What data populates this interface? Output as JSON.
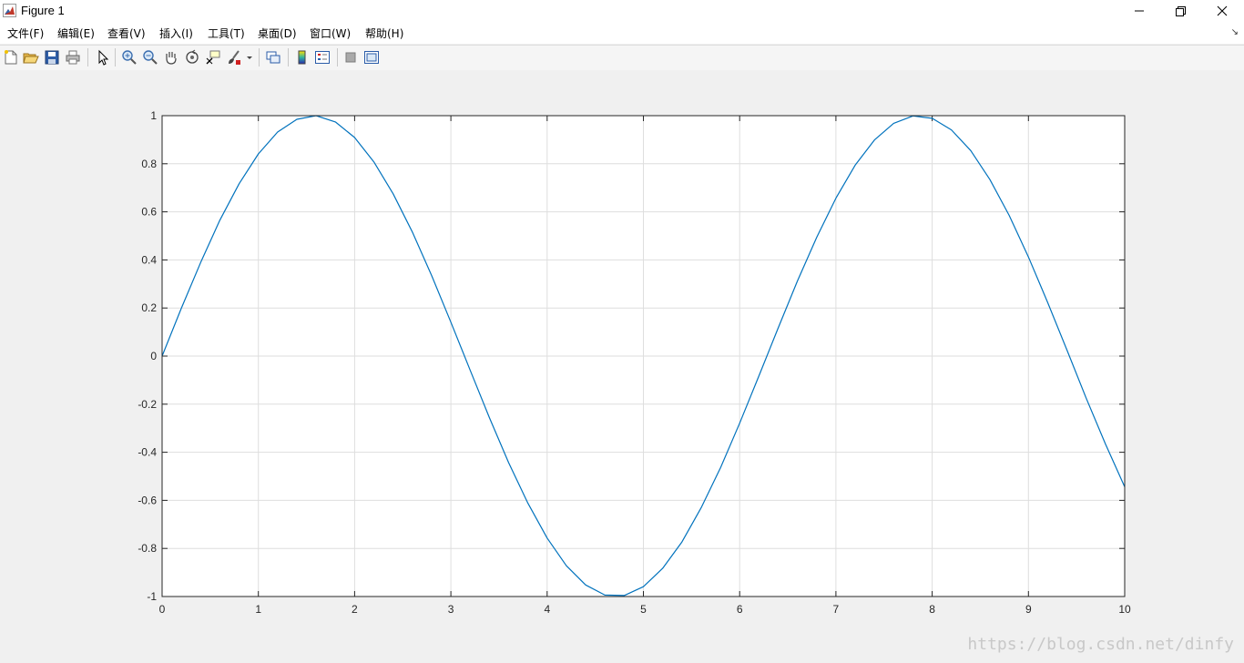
{
  "window": {
    "title": "Figure 1",
    "controls": [
      "minimize",
      "restore",
      "close"
    ]
  },
  "menu": {
    "items": [
      "文件(F)",
      "编辑(E)",
      "查看(V)",
      "插入(I)",
      "工具(T)",
      "桌面(D)",
      "窗口(W)",
      "帮助(H)"
    ]
  },
  "toolbar": {
    "icons": [
      "new-figure-icon",
      "open-file-icon",
      "save-icon",
      "print-icon",
      "edit-plot-arrow-icon",
      "zoom-in-icon",
      "zoom-out-icon",
      "pan-hand-icon",
      "rotate-3d-icon",
      "data-cursor-icon",
      "brush-icon",
      "link-plot-icon",
      "insert-colorbar-icon",
      "insert-legend-icon",
      "hide-plot-tools-icon",
      "show-plot-tools-icon"
    ]
  },
  "chart_data": {
    "type": "line",
    "function": "sin(x)",
    "xlim": [
      0,
      10
    ],
    "ylim": [
      -1,
      1
    ],
    "grid": true,
    "x_ticks": [
      "0",
      "1",
      "2",
      "3",
      "4",
      "5",
      "6",
      "7",
      "8",
      "9",
      "10"
    ],
    "y_ticks": [
      "-1",
      "-0.8",
      "-0.6",
      "-0.4",
      "-0.2",
      "0",
      "0.2",
      "0.4",
      "0.6",
      "0.8",
      "1"
    ],
    "series": [
      {
        "color": "#0072bd",
        "x": [
          0,
          0.2,
          0.4,
          0.6,
          0.8,
          1,
          1.2,
          1.4,
          1.6,
          1.8,
          2,
          2.2,
          2.4,
          2.6,
          2.8,
          3,
          3.2,
          3.4,
          3.6,
          3.8,
          4,
          4.2,
          4.4,
          4.6,
          4.8,
          5,
          5.2,
          5.4,
          5.6,
          5.8,
          6,
          6.2,
          6.4,
          6.6,
          6.8,
          7,
          7.2,
          7.4,
          7.6,
          7.8,
          8,
          8.2,
          8.4,
          8.6,
          8.8,
          9,
          9.2,
          9.4,
          9.6,
          9.8,
          10
        ],
        "y": [
          0,
          0.199,
          0.389,
          0.565,
          0.717,
          0.841,
          0.932,
          0.985,
          1.0,
          0.974,
          0.909,
          0.808,
          0.675,
          0.516,
          0.335,
          0.141,
          -0.058,
          -0.256,
          -0.443,
          -0.612,
          -0.757,
          -0.872,
          -0.952,
          -0.994,
          -0.996,
          -0.959,
          -0.883,
          -0.773,
          -0.631,
          -0.465,
          -0.279,
          -0.083,
          0.117,
          0.312,
          0.494,
          0.657,
          0.794,
          0.899,
          0.968,
          0.999,
          0.989,
          0.941,
          0.855,
          0.734,
          0.585,
          0.412,
          0.223,
          0.025,
          -0.175,
          -0.366,
          -0.544
        ]
      }
    ]
  },
  "watermark": "https://blog.csdn.net/dinfy"
}
